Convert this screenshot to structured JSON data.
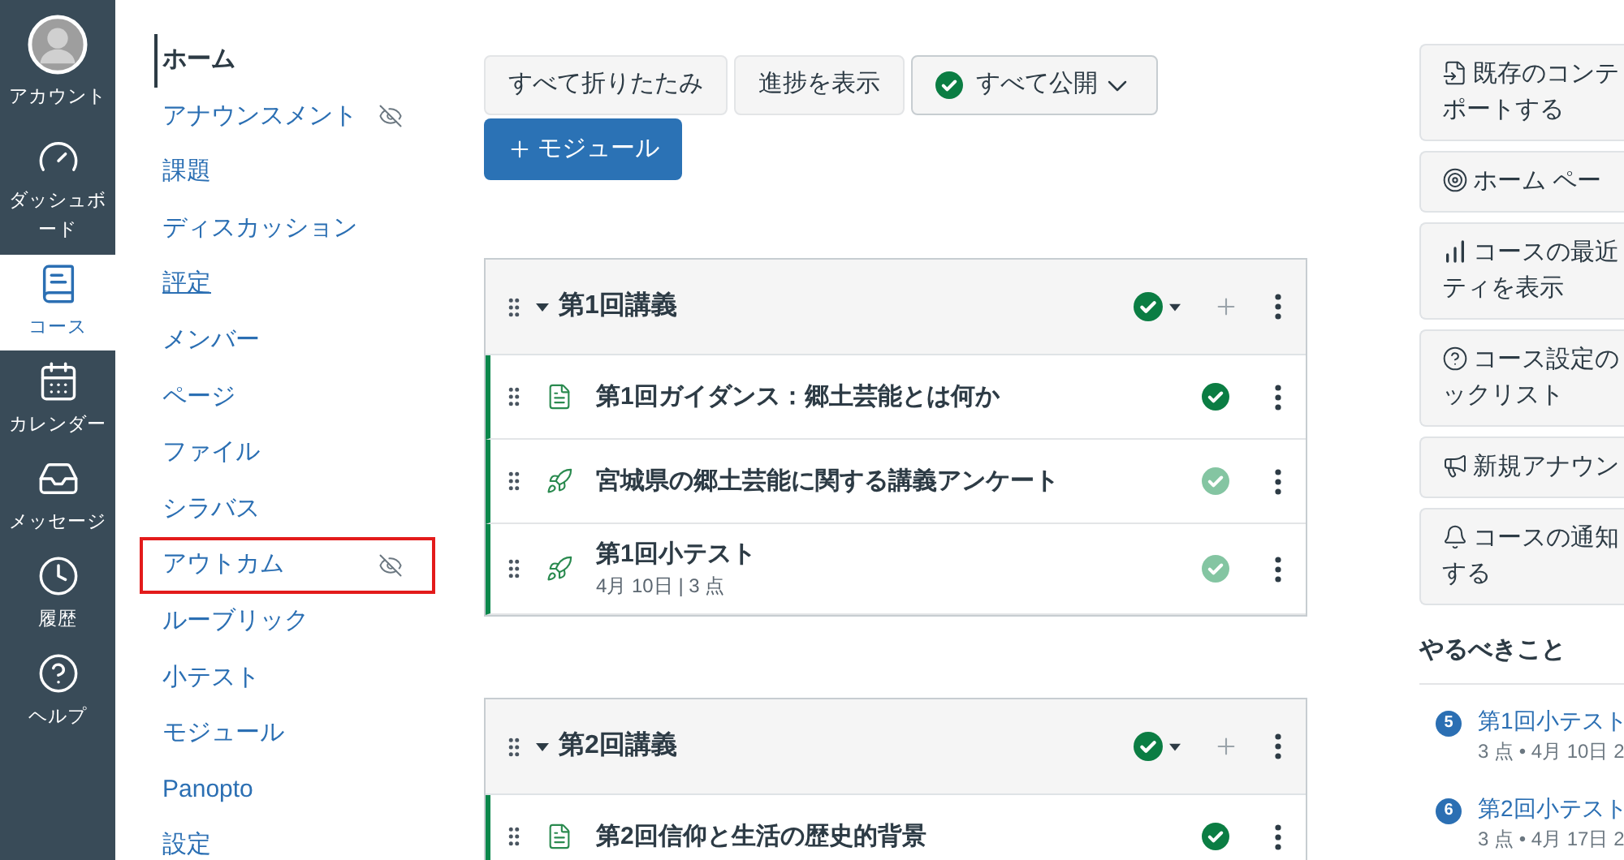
{
  "global_nav": [
    {
      "kind": "account",
      "label": "アカウント",
      "selected": false
    },
    {
      "kind": "dashboard",
      "label": "ダッシュボード",
      "selected": false
    },
    {
      "kind": "courses",
      "label": "コース",
      "selected": true
    },
    {
      "kind": "calendar",
      "label": "カレンダー",
      "selected": false
    },
    {
      "kind": "inbox",
      "label": "メッセージ",
      "selected": false
    },
    {
      "kind": "history",
      "label": "履歴",
      "selected": false
    },
    {
      "kind": "help",
      "label": "ヘルプ",
      "selected": false
    }
  ],
  "course_nav": [
    {
      "label": "ホーム",
      "selected": true,
      "hidden": false,
      "underlined": false,
      "highlighted": false
    },
    {
      "label": "アナウンスメント",
      "selected": false,
      "hidden": true,
      "underlined": false,
      "highlighted": false
    },
    {
      "label": "課題",
      "selected": false,
      "hidden": false,
      "underlined": false,
      "highlighted": false
    },
    {
      "label": "ディスカッション",
      "selected": false,
      "hidden": false,
      "underlined": false,
      "highlighted": false
    },
    {
      "label": "評定",
      "selected": false,
      "hidden": false,
      "underlined": true,
      "highlighted": false
    },
    {
      "label": "メンバー",
      "selected": false,
      "hidden": false,
      "underlined": false,
      "highlighted": false
    },
    {
      "label": "ページ",
      "selected": false,
      "hidden": false,
      "underlined": false,
      "highlighted": false
    },
    {
      "label": "ファイル",
      "selected": false,
      "hidden": false,
      "underlined": false,
      "highlighted": false
    },
    {
      "label": "シラバス",
      "selected": false,
      "hidden": false,
      "underlined": false,
      "highlighted": false
    },
    {
      "label": "アウトカム",
      "selected": false,
      "hidden": true,
      "underlined": false,
      "highlighted": true
    },
    {
      "label": "ルーブリック",
      "selected": false,
      "hidden": false,
      "underlined": false,
      "highlighted": false
    },
    {
      "label": "小テスト",
      "selected": false,
      "hidden": false,
      "underlined": false,
      "highlighted": false
    },
    {
      "label": "モジュール",
      "selected": false,
      "hidden": false,
      "underlined": false,
      "highlighted": false
    },
    {
      "label": "Panopto",
      "selected": false,
      "hidden": false,
      "underlined": false,
      "highlighted": false
    },
    {
      "label": "設定",
      "selected": false,
      "hidden": false,
      "underlined": false,
      "highlighted": false
    }
  ],
  "toolbar": [
    {
      "kind": "plain",
      "label": "すべて折りたたみ"
    },
    {
      "kind": "plain",
      "label": "進捗を表示"
    },
    {
      "kind": "publish_menu",
      "label": "すべて公開"
    },
    {
      "kind": "primary",
      "label": "モジュール"
    }
  ],
  "modules": [
    {
      "title": "第1回講義",
      "expanded": true,
      "published": true,
      "items": [
        {
          "kind": "page",
          "title": "第1回ガイダンス：郷土芸能とは何か",
          "published": true,
          "disabled": false
        },
        {
          "kind": "quiz",
          "title": "宮城県の郷土芸能に関する講義アンケート",
          "published": true,
          "disabled": true
        },
        {
          "kind": "quiz",
          "title": "第1回小テスト",
          "details": "4月 10日 | 3 点",
          "published": true,
          "disabled": true
        }
      ]
    },
    {
      "title": "第2回講義",
      "expanded": true,
      "published": true,
      "items": [
        {
          "kind": "page",
          "title": "第2回信仰と生活の歴史的背景",
          "published": true,
          "disabled": false
        }
      ]
    }
  ],
  "sidebar": {
    "actions": [
      {
        "kind": "import",
        "lines": [
          "既存のコンテ",
          "ポートする"
        ]
      },
      {
        "kind": "home_page",
        "lines": [
          "ホーム ペー"
        ]
      },
      {
        "kind": "activity",
        "lines": [
          "コースの最近",
          "ティを表示"
        ]
      },
      {
        "kind": "checklist",
        "lines": [
          "コース設定の",
          "ックリスト"
        ]
      },
      {
        "kind": "announcement",
        "lines": [
          "新規アナウン"
        ]
      },
      {
        "kind": "notifications",
        "lines": [
          "コースの通知",
          "する"
        ]
      }
    ],
    "todo": {
      "title": "やるべきこと",
      "items": [
        {
          "badge": "5",
          "title": "第1回小テスト",
          "details": "3 点 • 4月 10日 2"
        },
        {
          "badge": "6",
          "title": "第2回小テスト",
          "details": "3 点 • 4月 17日 2"
        }
      ]
    }
  }
}
